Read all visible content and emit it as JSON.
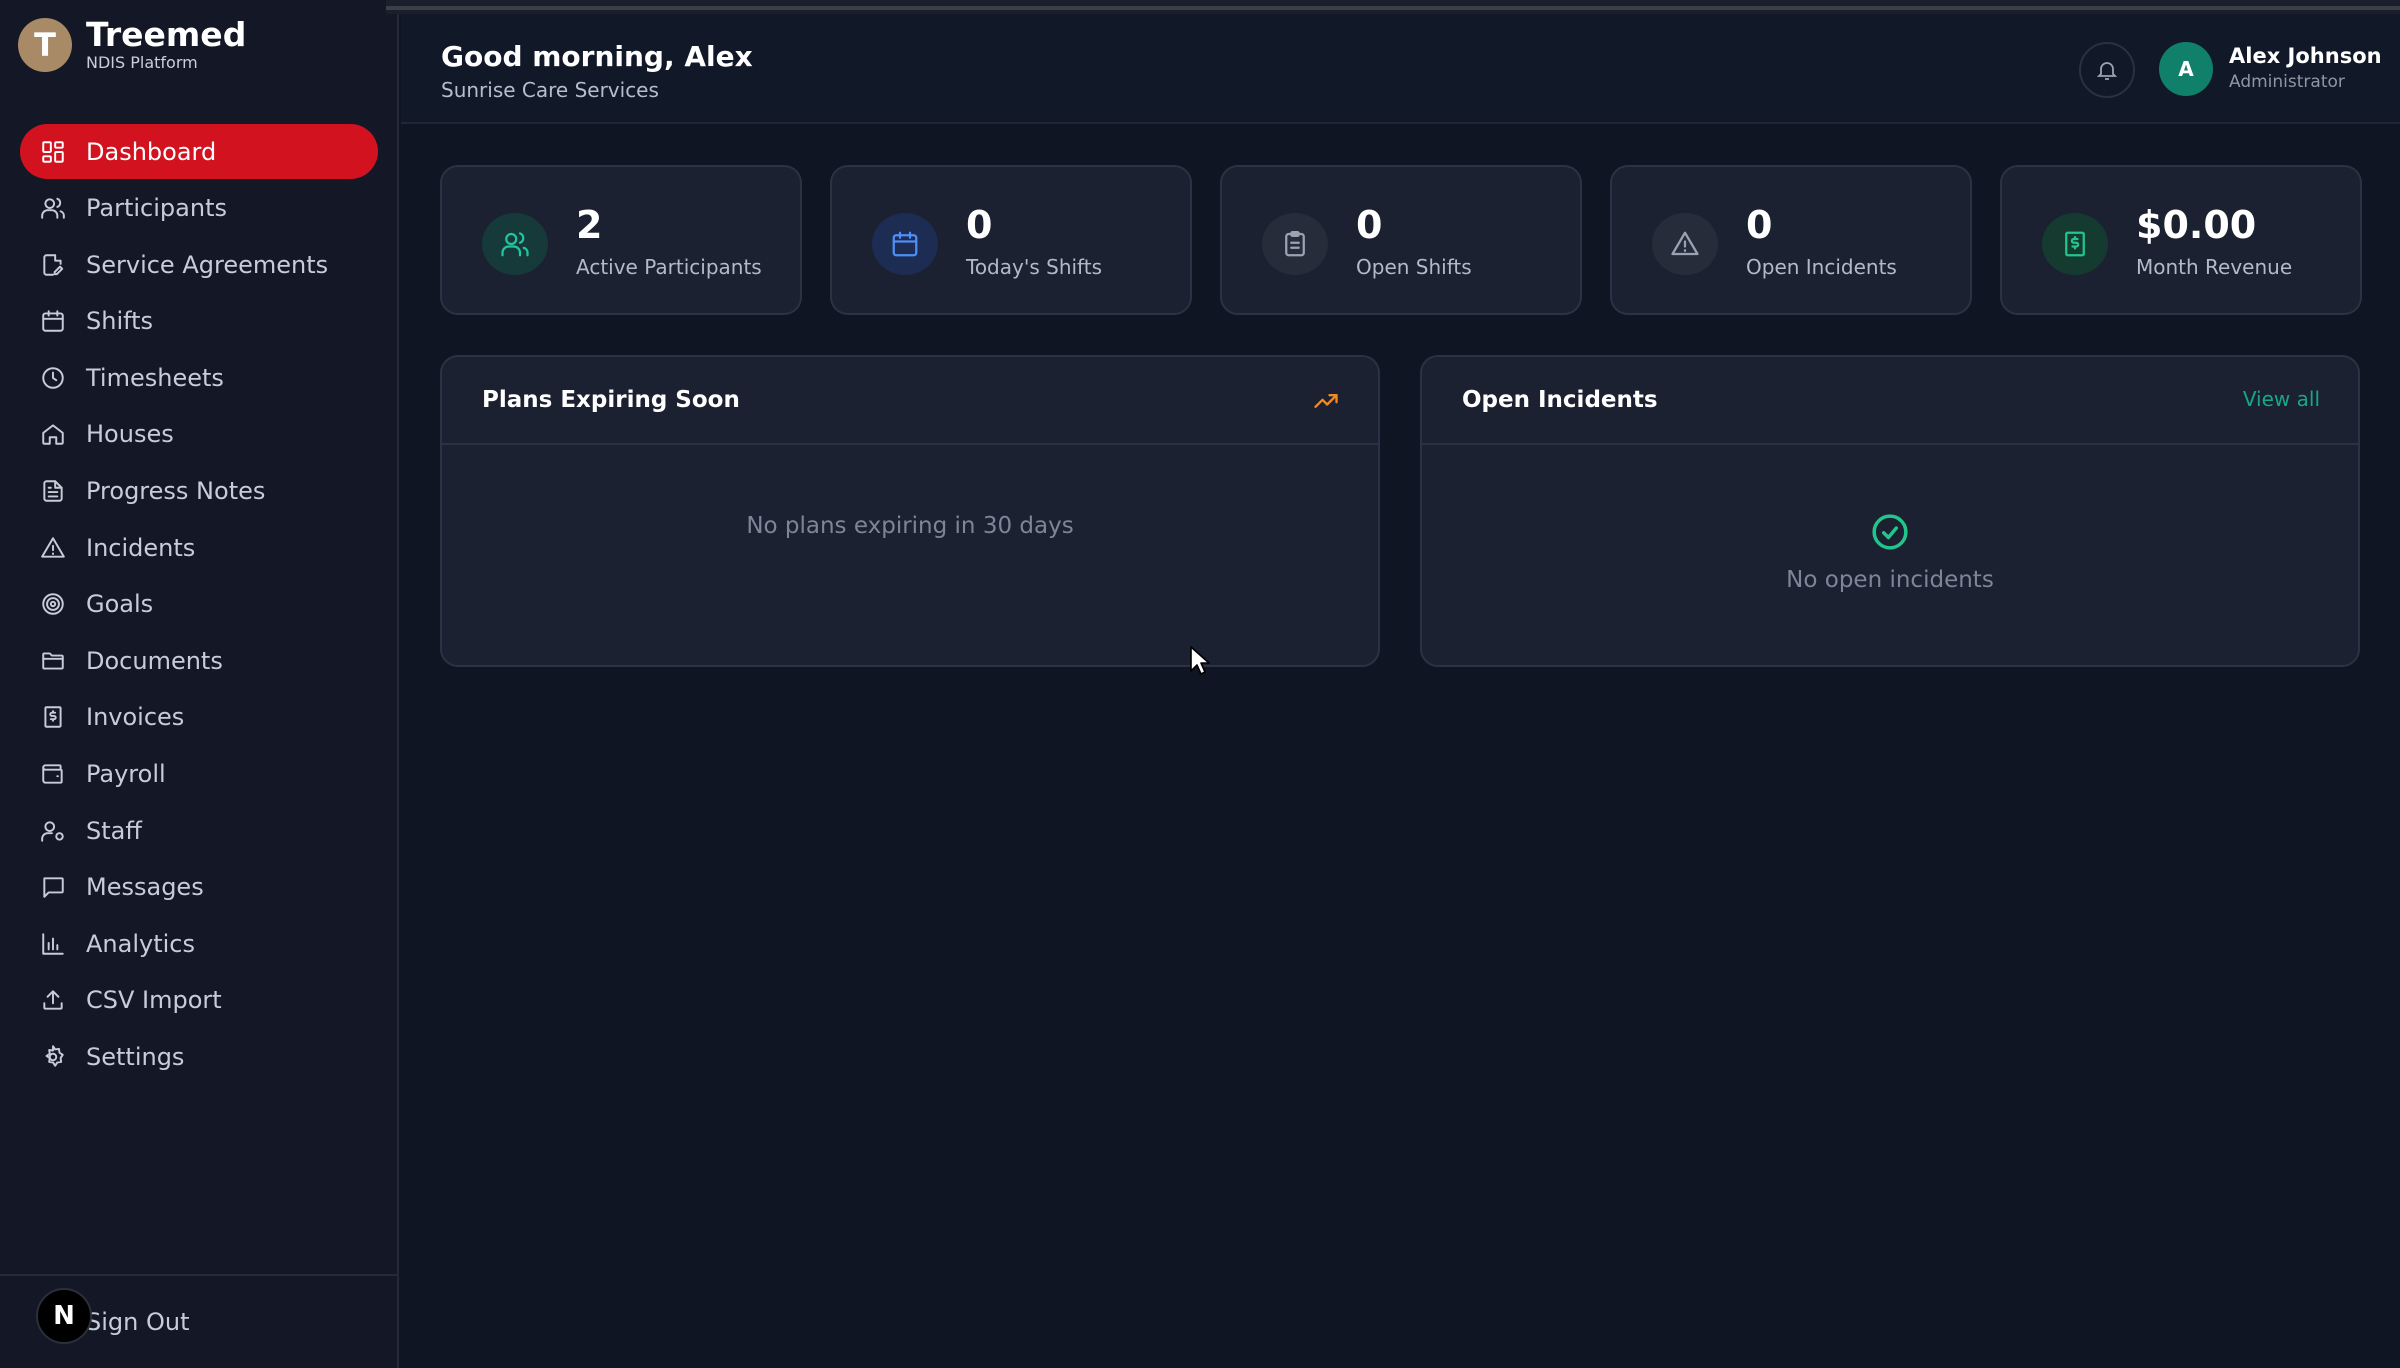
{
  "brand": {
    "logo_letter": "T",
    "name": "Treemed",
    "subtitle": "NDIS Platform"
  },
  "sidebar": {
    "items": [
      {
        "label": "Dashboard",
        "icon": "dashboard-icon",
        "active": true
      },
      {
        "label": "Participants",
        "icon": "users-icon"
      },
      {
        "label": "Service Agreements",
        "icon": "file-signature-icon"
      },
      {
        "label": "Shifts",
        "icon": "calendar-icon"
      },
      {
        "label": "Timesheets",
        "icon": "clock-icon"
      },
      {
        "label": "Houses",
        "icon": "house-icon"
      },
      {
        "label": "Progress Notes",
        "icon": "notes-icon"
      },
      {
        "label": "Incidents",
        "icon": "warning-icon"
      },
      {
        "label": "Goals",
        "icon": "target-icon"
      },
      {
        "label": "Documents",
        "icon": "folder-icon"
      },
      {
        "label": "Invoices",
        "icon": "receipt-icon"
      },
      {
        "label": "Payroll",
        "icon": "wallet-icon"
      },
      {
        "label": "Staff",
        "icon": "user-cog-icon"
      },
      {
        "label": "Messages",
        "icon": "message-icon"
      },
      {
        "label": "Analytics",
        "icon": "bar-chart-icon"
      },
      {
        "label": "CSV Import",
        "icon": "upload-icon"
      },
      {
        "label": "Settings",
        "icon": "gear-icon"
      }
    ],
    "signout_label": "Sign Out",
    "badge_letter": "N"
  },
  "header": {
    "greeting": "Good morning, Alex",
    "organization": "Sunrise Care Services",
    "user": {
      "initial": "A",
      "name": "Alex Johnson",
      "role": "Administrator"
    }
  },
  "stats": [
    {
      "value": "2",
      "label": "Active Participants",
      "icon": "users-icon",
      "color": "#22c5a0"
    },
    {
      "value": "0",
      "label": "Today's Shifts",
      "icon": "calendar-icon",
      "color": "#4f8ef7"
    },
    {
      "value": "0",
      "label": "Open Shifts",
      "icon": "clipboard-icon",
      "color": "#9aa3b3"
    },
    {
      "value": "0",
      "label": "Open Incidents",
      "icon": "warning-icon",
      "color": "#9aa3b3"
    },
    {
      "value": "$0.00",
      "label": "Month Revenue",
      "icon": "receipt-icon",
      "color": "#22c58b"
    }
  ],
  "panels": {
    "plans": {
      "title": "Plans Expiring Soon",
      "icon": "trending-up-icon",
      "empty": "No plans expiring in 30 days"
    },
    "incidents": {
      "title": "Open Incidents",
      "action": "View all",
      "icon": "check-circle-icon",
      "empty": "No open incidents"
    }
  },
  "colors": {
    "accent": "#d31220",
    "teal": "#17a68a",
    "orange": "#f08a24"
  }
}
